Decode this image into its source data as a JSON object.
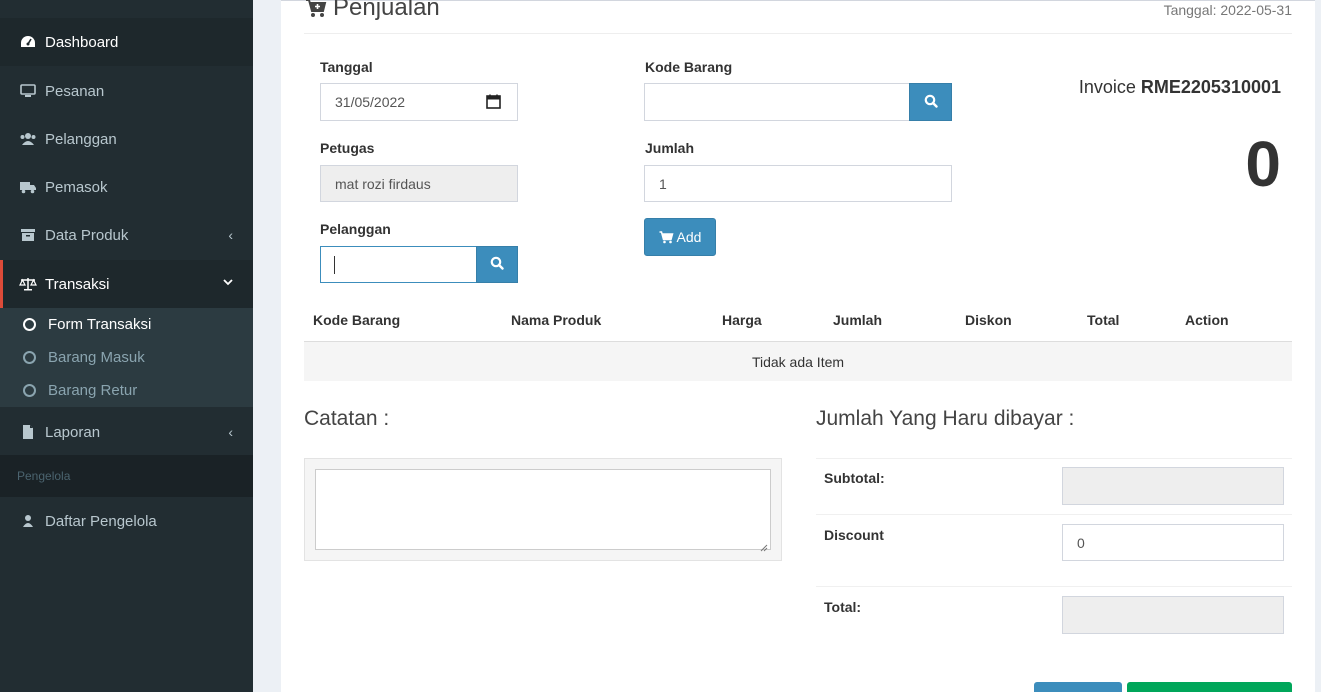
{
  "sidebar": {
    "items": [
      {
        "label": "Dashboard",
        "icon": "dashboard-icon"
      },
      {
        "label": "Pesanan",
        "icon": "monitor-icon"
      },
      {
        "label": "Pelanggan",
        "icon": "users-icon"
      },
      {
        "label": "Pemasok",
        "icon": "truck-icon"
      },
      {
        "label": "Data Produk",
        "icon": "archive-icon"
      },
      {
        "label": "Transaksi",
        "icon": "balance-scale-icon"
      },
      {
        "label": "Laporan",
        "icon": "file-icon"
      }
    ],
    "submenu": [
      "Form Transaksi",
      "Barang Masuk",
      "Barang Retur"
    ],
    "header": "Pengelola",
    "admin_item": "Daftar Pengelola"
  },
  "page": {
    "title": "Penjualan",
    "date_top": "Tanggal: 2022-05-31"
  },
  "form": {
    "tanggal_label": "Tanggal",
    "tanggal_value": "31/05/2022",
    "petugas_label": "Petugas",
    "petugas_value": "mat rozi firdaus",
    "pelanggan_label": "Pelanggan",
    "pelanggan_value": "",
    "kode_barang_label": "Kode Barang",
    "kode_barang_value": "",
    "jumlah_label": "Jumlah",
    "jumlah_value": "1",
    "add_label": "Add"
  },
  "invoice": {
    "prefix": "Invoice",
    "number": "RME2205310001",
    "total_display": "0"
  },
  "table": {
    "headers": [
      "Kode Barang",
      "Nama Produk",
      "Harga",
      "Jumlah",
      "Diskon",
      "Total",
      "Action"
    ],
    "empty_text": "Tidak ada Item"
  },
  "notes": {
    "heading": "Catatan :",
    "value": ""
  },
  "summary": {
    "heading": "Jumlah Yang Haru dibayar :",
    "subtotal_label": "Subtotal:",
    "subtotal_value": "",
    "discount_label": "Discount",
    "discount_value": "0",
    "total_label": "Total:",
    "total_value": ""
  },
  "colors": {
    "sidebar_bg": "#222d32",
    "accent_red": "#dd4b39",
    "primary_blue": "#3c8dbc",
    "success_green": "#00a65a"
  }
}
